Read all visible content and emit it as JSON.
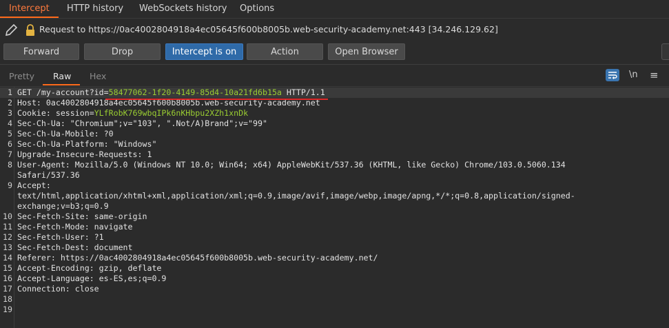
{
  "top_tabs": [
    "Intercept",
    "HTTP history",
    "WebSockets history",
    "Options"
  ],
  "request_bar": {
    "text": "Request to https://0ac4002804918a4ec05645f600b8005b.web-security-academy.net:443  [34.246.129.62]"
  },
  "buttons": {
    "forward": "Forward",
    "drop": "Drop",
    "intercept": "Intercept is on",
    "action": "Action",
    "open_browser": "Open Browser"
  },
  "view_tabs": [
    "Pretty",
    "Raw",
    "Hex"
  ],
  "view_icons": {
    "newline_label": "\\n",
    "menu_label": "≡"
  },
  "colors": {
    "accent": "#ff6a1a",
    "primary_button": "#2f6aa8",
    "param_value": "#9acd32",
    "highlight_underline": "#e02a2a"
  },
  "request_lines": [
    {
      "num": "1",
      "parts": [
        {
          "t": "GET /my-account?id=",
          "c": ""
        },
        {
          "t": "58477062-1f20-4149-85d4-10a21fd6b15a",
          "c": "green"
        },
        {
          "t": " HTTP/1.1",
          "c": ""
        }
      ]
    },
    {
      "num": "2",
      "parts": [
        {
          "t": "Host: 0ac4002804918a4ec05645f600b8005b.web-security-academy.net",
          "c": ""
        }
      ]
    },
    {
      "num": "3",
      "parts": [
        {
          "t": "Cookie: session=",
          "c": ""
        },
        {
          "t": "YLfRobK769wbqIPk6nKHbpu2XZh1xnDk",
          "c": "green"
        }
      ]
    },
    {
      "num": "4",
      "parts": [
        {
          "t": "Sec-Ch-Ua: \"Chromium\";v=\"103\", \".Not/A)Brand\";v=\"99\"",
          "c": ""
        }
      ]
    },
    {
      "num": "5",
      "parts": [
        {
          "t": "Sec-Ch-Ua-Mobile: ?0",
          "c": ""
        }
      ]
    },
    {
      "num": "6",
      "parts": [
        {
          "t": "Sec-Ch-Ua-Platform: \"Windows\"",
          "c": ""
        }
      ]
    },
    {
      "num": "7",
      "parts": [
        {
          "t": "Upgrade-Insecure-Requests: 1",
          "c": ""
        }
      ]
    },
    {
      "num": "8",
      "parts": [
        {
          "t": "User-Agent: Mozilla/5.0 (Windows NT 10.0; Win64; x64) AppleWebKit/537.36 (KHTML, like Gecko) Chrome/103.0.5060.134",
          "c": ""
        }
      ]
    },
    {
      "num": "",
      "parts": [
        {
          "t": "Safari/537.36",
          "c": ""
        }
      ]
    },
    {
      "num": "9",
      "parts": [
        {
          "t": "Accept:",
          "c": ""
        }
      ]
    },
    {
      "num": "",
      "parts": [
        {
          "t": "text/html,application/xhtml+xml,application/xml;q=0.9,image/avif,image/webp,image/apng,*/*;q=0.8,application/signed-",
          "c": ""
        }
      ]
    },
    {
      "num": "",
      "parts": [
        {
          "t": "exchange;v=b3;q=0.9",
          "c": ""
        }
      ]
    },
    {
      "num": "10",
      "parts": [
        {
          "t": "Sec-Fetch-Site: same-origin",
          "c": ""
        }
      ]
    },
    {
      "num": "11",
      "parts": [
        {
          "t": "Sec-Fetch-Mode: navigate",
          "c": ""
        }
      ]
    },
    {
      "num": "12",
      "parts": [
        {
          "t": "Sec-Fetch-User: ?1",
          "c": ""
        }
      ]
    },
    {
      "num": "13",
      "parts": [
        {
          "t": "Sec-Fetch-Dest: document",
          "c": ""
        }
      ]
    },
    {
      "num": "14",
      "parts": [
        {
          "t": "Referer: https://0ac4002804918a4ec05645f600b8005b.web-security-academy.net/",
          "c": ""
        }
      ]
    },
    {
      "num": "15",
      "parts": [
        {
          "t": "Accept-Encoding: gzip, deflate",
          "c": ""
        }
      ]
    },
    {
      "num": "16",
      "parts": [
        {
          "t": "Accept-Language: es-ES,es;q=0.9",
          "c": ""
        }
      ]
    },
    {
      "num": "17",
      "parts": [
        {
          "t": "Connection: close",
          "c": ""
        }
      ]
    },
    {
      "num": "18",
      "parts": []
    },
    {
      "num": "19",
      "parts": []
    }
  ]
}
